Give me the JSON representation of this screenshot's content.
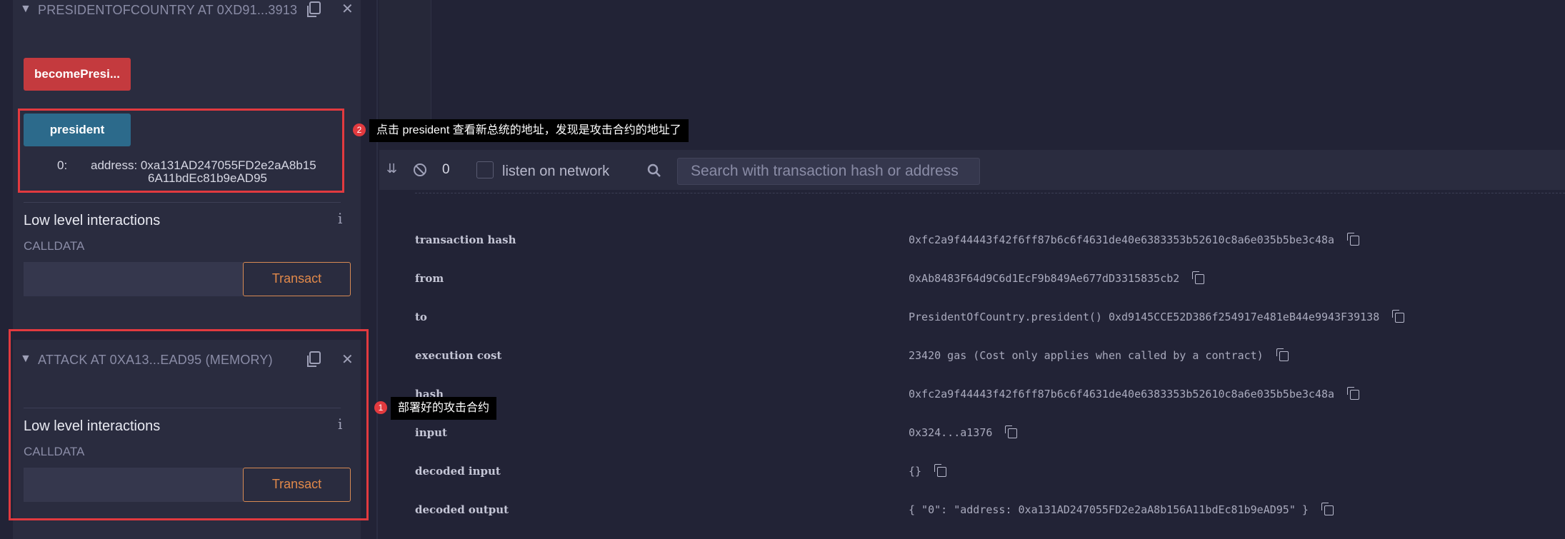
{
  "deployed_contracts": [
    {
      "title": "PRESIDENTOFCOUNTRY AT 0XD91...3913",
      "functions": [
        {
          "label": "becomePresi...",
          "color": "#c43a3e"
        },
        {
          "label": "president",
          "color": "#2c6a8b",
          "output_index": "0:",
          "output_line1": "address: 0xa131AD247055FD2e2aA8b15",
          "output_line2": "6A11bdEc81b9eAD95"
        }
      ],
      "low_level_title": "Low level interactions",
      "calldata_label": "CALLDATA",
      "transact_label": "Transact"
    },
    {
      "title": "ATTACK AT 0XA13...EAD95 (MEMORY)",
      "low_level_title": "Low level interactions",
      "calldata_label": "CALLDATA",
      "transact_label": "Transact"
    }
  ],
  "annotations": [
    {
      "number": "2",
      "text": "点击 president 查看新总统的地址，发现是攻击合约的地址了"
    },
    {
      "number": "1",
      "text": "部署好的攻击合约"
    }
  ],
  "terminal": {
    "pending_count": "0",
    "listen_label": "listen on network",
    "search_placeholder": "Search with transaction hash or address"
  },
  "transaction": [
    {
      "key": "transaction hash",
      "value": "0xfc2a9f44443f42f6ff87b6c6f4631de40e6383353b52610c8a6e035b5be3c48a"
    },
    {
      "key": "from",
      "value": "0xAb8483F64d9C6d1EcF9b849Ae677dD3315835cb2"
    },
    {
      "key": "to",
      "value": "PresidentOfCountry.president() 0xd9145CCE52D386f254917e481eB44e9943F39138"
    },
    {
      "key": "execution cost",
      "value": "23420 gas (Cost only applies when called by a contract)"
    },
    {
      "key": "hash",
      "value": "0xfc2a9f44443f42f6ff87b6c6f4631de40e6383353b52610c8a6e035b5be3c48a"
    },
    {
      "key": "input",
      "value": "0x324...a1376"
    },
    {
      "key": "decoded input",
      "value": "{}"
    },
    {
      "key": "decoded output",
      "value": "{ \"0\": \"address: 0xa131AD247055FD2e2aA8b156A11bdEc81b9eAD95\" }"
    }
  ],
  "colors": {
    "accent_red": "#e23a3f",
    "transact_orange": "#e1894a",
    "background": "#222336"
  }
}
